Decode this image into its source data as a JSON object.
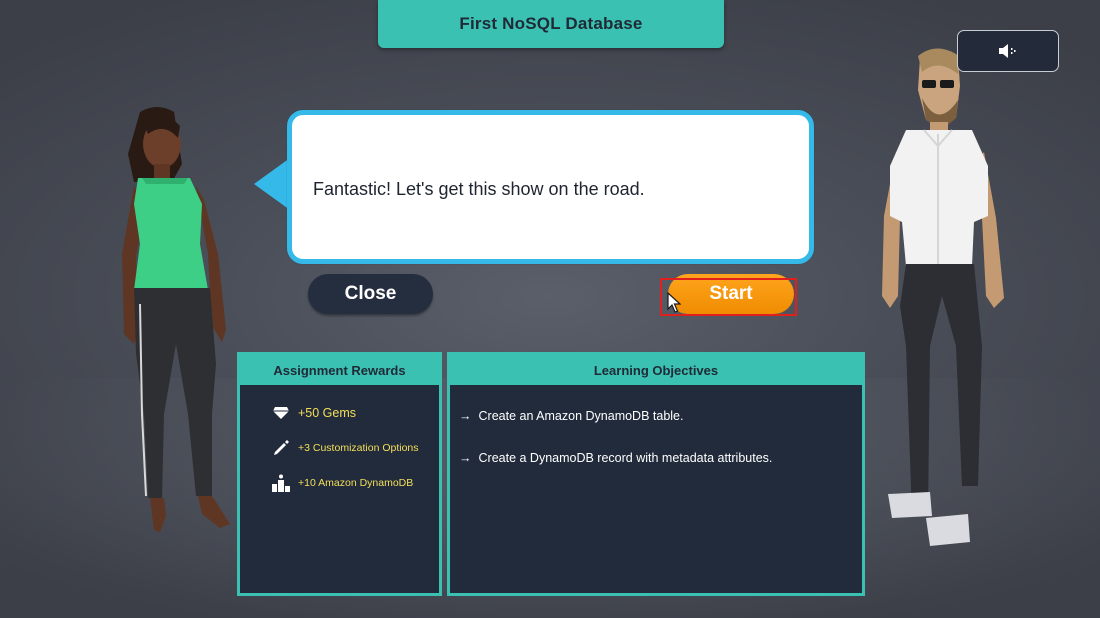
{
  "header": {
    "title": "First NoSQL Database"
  },
  "sound": {
    "icon": "speaker-icon"
  },
  "dialog": {
    "message": "Fantastic! Let's get this show on the road."
  },
  "buttons": {
    "close_label": "Close",
    "start_label": "Start"
  },
  "rewards": {
    "title": "Assignment Rewards",
    "items": [
      {
        "icon": "gem-icon",
        "label": "+50 Gems"
      },
      {
        "icon": "pencil-icon",
        "label": "+3 Customization Options"
      },
      {
        "icon": "podium-icon",
        "label": "+10 Amazon DynamoDB"
      }
    ]
  },
  "objectives": {
    "title": "Learning Objectives",
    "arrow": "→",
    "items": [
      "Create an Amazon DynamoDB table.",
      "Create a DynamoDB record with metadata attributes."
    ]
  },
  "colors": {
    "accent_teal": "#3bc1b1",
    "bubble_border": "#34b9e9",
    "start_orange": "#f7941d",
    "panel_bg": "#222b3b",
    "reward_text": "#f4df5a",
    "highlight_red": "#e0201c"
  }
}
